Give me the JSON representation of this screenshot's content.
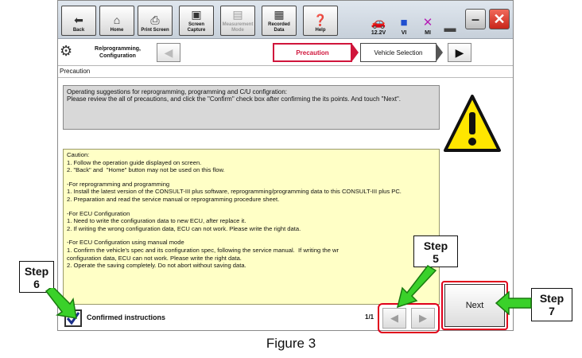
{
  "toolbar": {
    "back": "Back",
    "home": "Home",
    "print_screen": "Print Screen",
    "screen_capture": "Screen Capture",
    "measurement_mode": "Measurement Mode",
    "recorded_data": "Recorded Data",
    "help": "Help",
    "status_battery": "12.2V",
    "status_vi": "VI",
    "status_mi": "MI"
  },
  "crumbs": {
    "mode_label": "Re/programming, Configuration",
    "active_step": "Precaution",
    "next_step": "Vehicle Selection"
  },
  "section_title": "Precaution",
  "info_text": "Operating suggestions for reprogramming, programming and C/U configration:\nPlease review the all of precautions, and click the \"Confirm\" check box after confirming the its points. And touch \"Next\".",
  "caution": {
    "title": "Caution:",
    "general": [
      "1. Follow the operation guide displayed on screen.",
      "2. \"Back\" and  \"Home\" button may not be used on this flow."
    ],
    "reprog_title": "-For reprogramming and programming",
    "reprog": [
      "1. Install the latest version of the CONSULT-III plus software, reprogramming/programming data to this CONSULT-III plus PC.",
      "2. Preparation and read the service manual or reprogramming procedure sheet."
    ],
    "ecu_title": "-For ECU Configuration",
    "ecu": [
      "1. Need to write the configuration data to new ECU, after replace it.",
      "2. If writing the wrong configuration data, ECU can not work. Please write the right data."
    ],
    "manual_title": "-For ECU Configuration using manual mode",
    "manual": [
      "1. Confirm the vehicle's spec and its configuration spec, following the service manual.  If writing the wr",
      "configuration data, ECU can not work. Please write the right data.",
      "2. Operate the saving completely. Do not abort without saving data."
    ]
  },
  "confirm_label": "Confirmed instructions",
  "pager": "1/1",
  "next_label": "Next",
  "callouts": {
    "step5_title": "Step",
    "step5_num": "5",
    "step6_title": "Step",
    "step6_num": "6",
    "step7_title": "Step",
    "step7_num": "7"
  },
  "figure_caption": "Figure 3",
  "colors": {
    "accent_red": "#d0153b",
    "caution_bg": "#ffffc6",
    "arrow_green": "#3ad12a"
  }
}
